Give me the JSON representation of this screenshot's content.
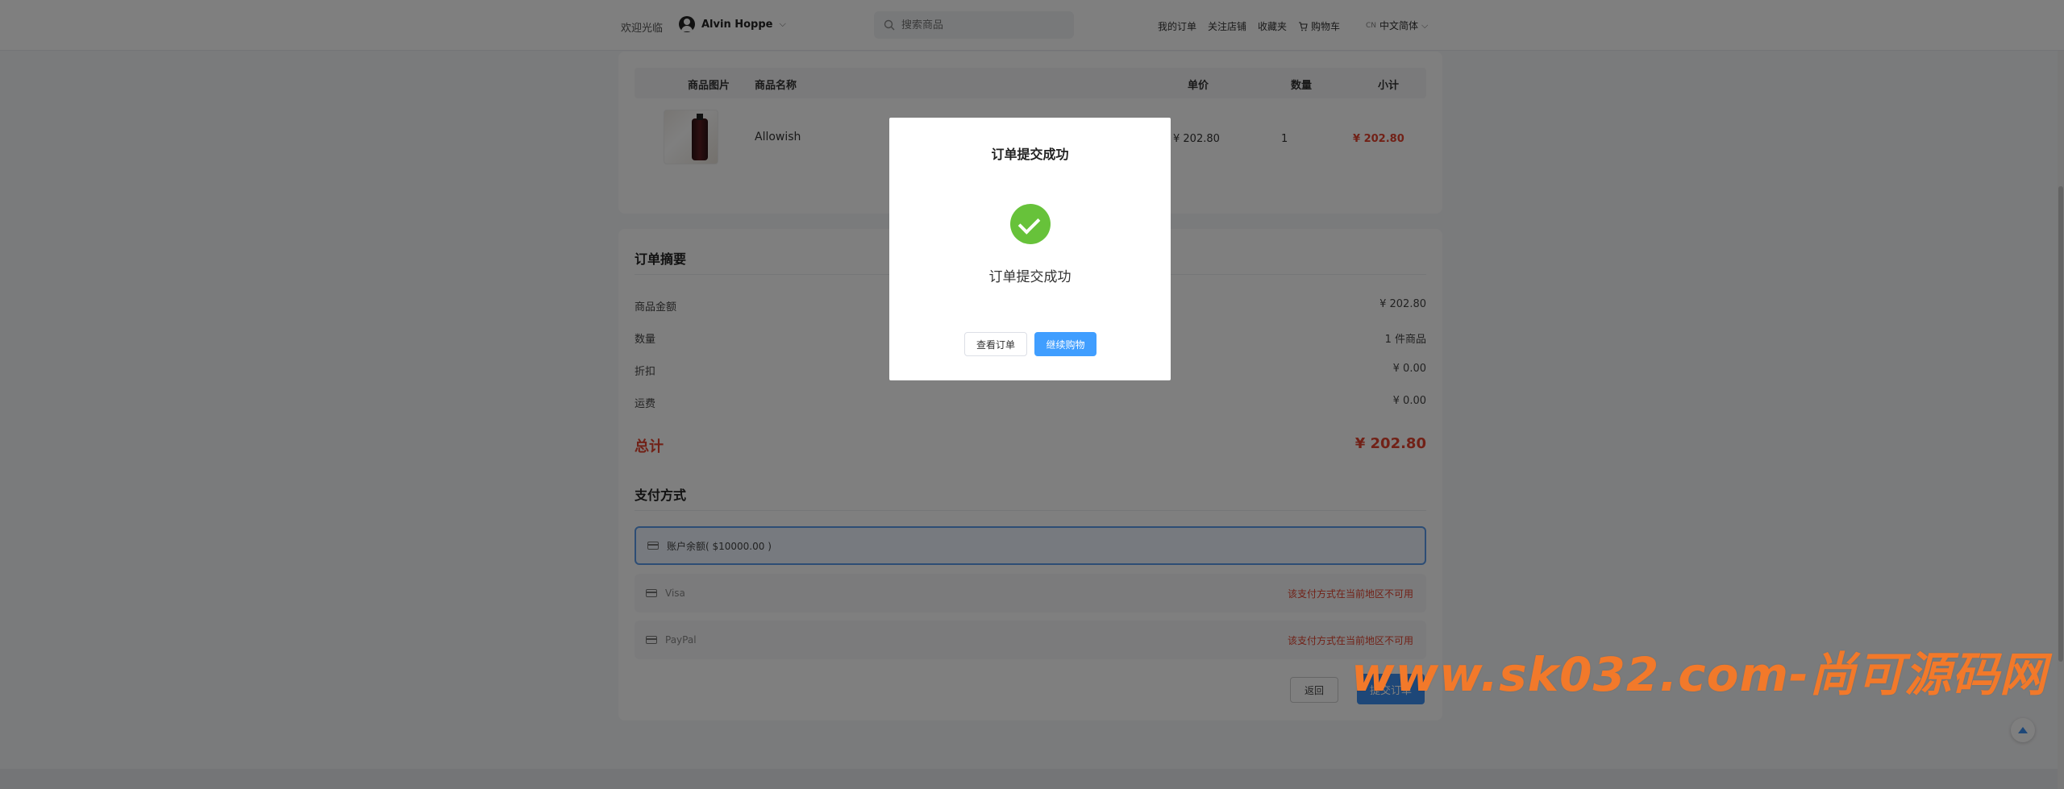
{
  "header": {
    "welcome": "欢迎光临",
    "user_name": "Alvin Hoppe",
    "search_placeholder": "搜索商品",
    "nav": {
      "my_orders": "我的订单",
      "followed_stores": "关注店铺",
      "favorites": "收藏夹",
      "cart": "购物车"
    },
    "lang_code": "CN",
    "lang": "中文简体"
  },
  "products_table": {
    "headers": {
      "image": "商品图片",
      "name": "商品名称",
      "unit_price": "单价",
      "quantity": "数量",
      "subtotal": "小计"
    },
    "row": {
      "name": "Allowish",
      "unit_price": "¥ 202.80",
      "quantity": "1",
      "subtotal": "¥ 202.80"
    }
  },
  "summary": {
    "title": "订单摘要",
    "rows": [
      {
        "label": "商品金额",
        "value": "¥ 202.80"
      },
      {
        "label": "数量",
        "value": "1 件商品"
      },
      {
        "label": "折扣",
        "value": "¥ 0.00"
      },
      {
        "label": "运费",
        "value": "¥ 0.00"
      }
    ],
    "total_label": "总计",
    "total_value": "¥ 202.80"
  },
  "payment": {
    "title": "支付方式",
    "options": [
      {
        "label": "账户余额( $10000.00 )",
        "note": ""
      },
      {
        "label": "Visa",
        "note": "该支付方式在当前地区不可用"
      },
      {
        "label": "PayPal",
        "note": "该支付方式在当前地区不可用"
      }
    ]
  },
  "actions": {
    "back": "返回",
    "submit": "提交订单"
  },
  "modal": {
    "title": "订单提交成功",
    "message": "订单提交成功",
    "view_order": "查看订单",
    "continue_shopping": "继续购物"
  },
  "watermark": "www.sk032.com-尚可源码网",
  "colors": {
    "accent": "#409eff",
    "price_red": "#e3432e",
    "success": "#67c23a"
  }
}
